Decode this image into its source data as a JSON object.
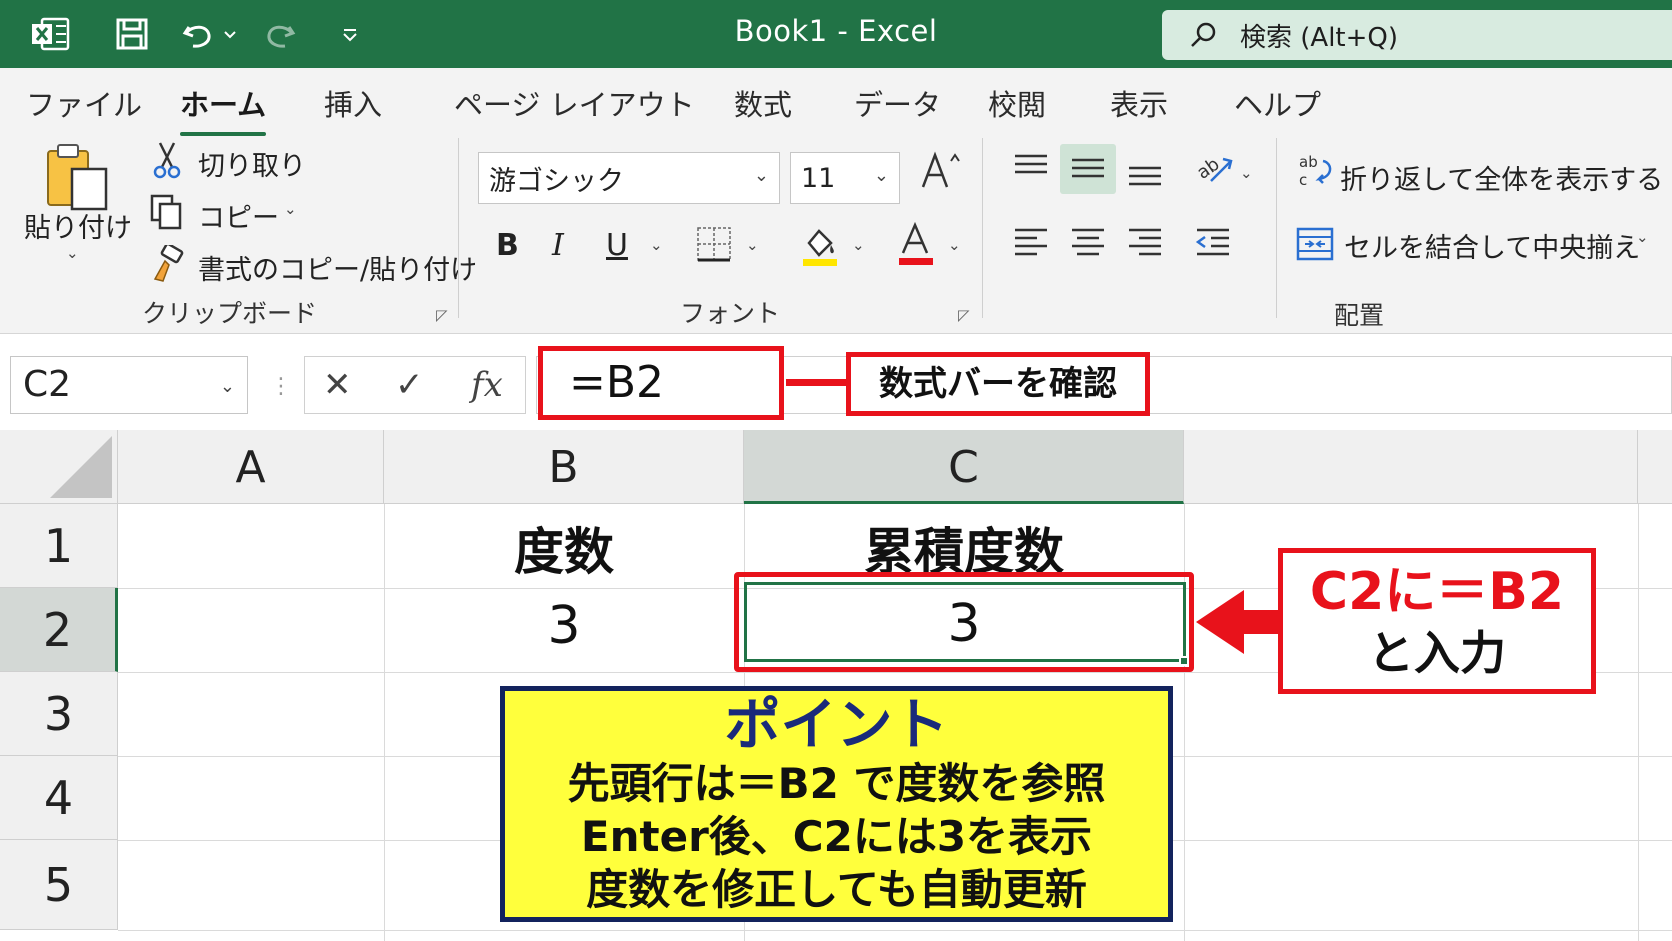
{
  "window": {
    "title": "Book1  -  Excel",
    "search_placeholder": "検索 (Alt+Q)"
  },
  "tabs": [
    "ファイル",
    "ホーム",
    "挿入",
    "ページ レイアウト",
    "数式",
    "データ",
    "校閲",
    "表示",
    "ヘルプ"
  ],
  "active_tab": "ホーム",
  "clipboard": {
    "paste_label": "貼り付け",
    "cut_label": "切り取り",
    "copy_label": "コピー",
    "format_painter_label": "書式のコピー/貼り付け",
    "group_label": "クリップボード"
  },
  "font": {
    "font_name": "游ゴシック",
    "font_size": "11",
    "bold": "B",
    "italic": "I",
    "underline": "U",
    "group_label": "フォント"
  },
  "alignment": {
    "wrap_text_label": "折り返して全体を表示する",
    "merge_label": "セルを結合して中央揃え",
    "group_label": "配置"
  },
  "formula_bar": {
    "name_box": "C2",
    "formula": "=B2",
    "fx_label": "fx"
  },
  "sheet": {
    "columns": [
      "A",
      "B",
      "C"
    ],
    "rows": [
      "1",
      "2",
      "3",
      "4",
      "5"
    ],
    "cells": {
      "B1": "度数",
      "C1": "累積度数",
      "B2": "3",
      "C2": "3"
    },
    "selected_cell": "C2"
  },
  "annotations": {
    "formula_bar_callout": "数式バーを確認",
    "cell_callout_line1": "C2に＝B2",
    "cell_callout_line2": "と入力",
    "point_title": "ポイント",
    "point_lines": [
      "先頭行は＝B2 で度数を参照",
      "Enter後、C2には3を表示",
      "度数を修正しても自動更新"
    ]
  },
  "colors": {
    "excel_green": "#217346",
    "callout_red": "#e8121b",
    "point_fill": "#ffff3c",
    "point_border": "#13235d"
  }
}
